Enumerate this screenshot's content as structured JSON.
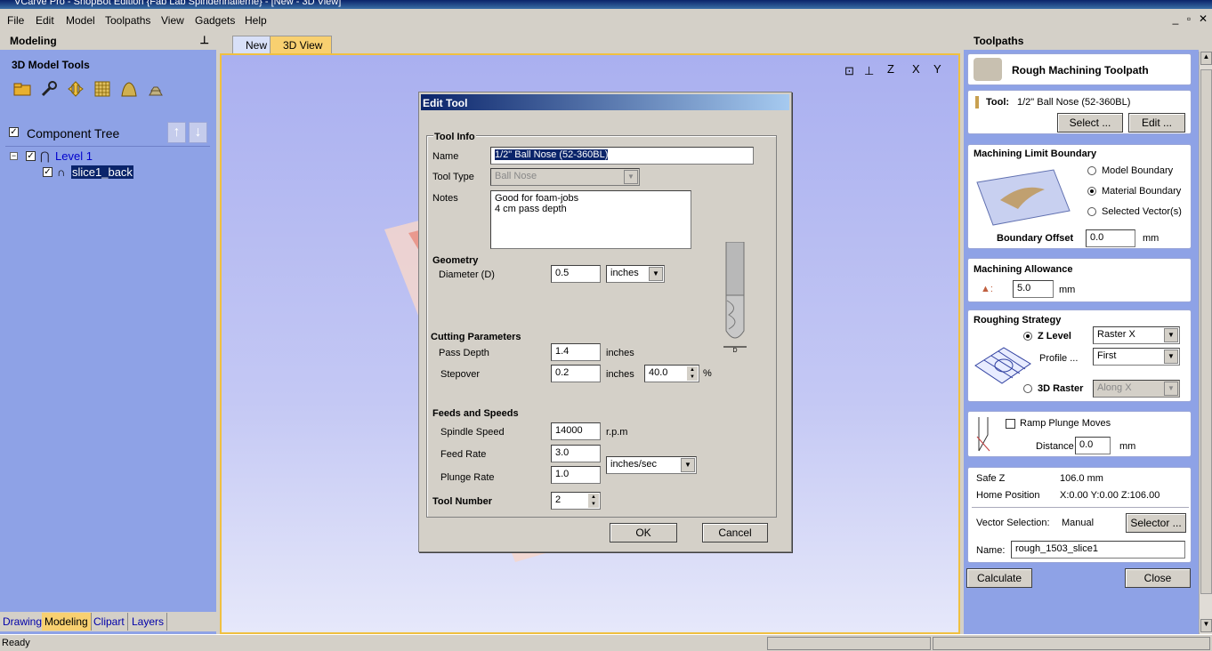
{
  "window": {
    "title": "VCarve Pro - ShopBot Edition {Fab Lab Spinderihallerne} - [New - 3D View]"
  },
  "menu": [
    "File",
    "Edit",
    "Model",
    "Toolpaths",
    "View",
    "Gadgets",
    "Help"
  ],
  "left": {
    "header": "Modeling",
    "tools_title": "3D Model Tools",
    "tree_title": "Component Tree",
    "tree": {
      "level": "Level 1",
      "component": "slice1_back"
    },
    "tabs": [
      "Drawing",
      "Modeling",
      "Clipart",
      "Layers"
    ]
  },
  "view_tabs": [
    "New",
    "3D View"
  ],
  "dialog": {
    "title": "Edit Tool",
    "tool_info": "Tool Info",
    "name_label": "Name",
    "name_value": "1/2\" Ball Nose  (52-360BL)",
    "tooltype_label": "Tool Type",
    "tooltype_value": "Ball Nose",
    "notes_label": "Notes",
    "notes_line1": "Good for foam-jobs",
    "notes_line2": "4 cm pass depth",
    "geometry": "Geometry",
    "diameter_label": "Diameter (D)",
    "diameter_value": "0.5",
    "diameter_units": "inches",
    "cutting": "Cutting Parameters",
    "pass_label": "Pass Depth",
    "pass_value": "1.4",
    "pass_units": "inches",
    "stepover_label": "Stepover",
    "stepover_value": "0.2",
    "stepover_units": "inches",
    "stepover_pct": "40.0",
    "pct": "%",
    "feeds": "Feeds and Speeds",
    "spindle_label": "Spindle Speed",
    "spindle_value": "14000",
    "spindle_units": "r.p.m",
    "feed_label": "Feed Rate",
    "feed_value": "3.0",
    "plunge_label": "Plunge Rate",
    "plunge_value": "1.0",
    "rate_units": "inches/sec",
    "toolnum_label": "Tool Number",
    "toolnum_value": "2",
    "ok": "OK",
    "cancel": "Cancel",
    "d_mark": "D"
  },
  "right": {
    "header": "Toolpaths",
    "title": "Rough Machining Toolpath",
    "tool_label": "Tool:",
    "tool_value": "1/2\" Ball Nose  (52-360BL)",
    "select_btn": "Select ...",
    "edit_btn": "Edit ...",
    "boundary_title": "Machining Limit Boundary",
    "model_boundary": "Model Boundary",
    "material_boundary": "Material Boundary",
    "selected_vectors": "Selected Vector(s)",
    "boundary_offset_label": "Boundary Offset",
    "boundary_offset_value": "0.0",
    "mm": "mm",
    "allowance_title": "Machining Allowance",
    "allowance_value": "5.0",
    "roughing_title": "Roughing Strategy",
    "zlevel": "Z Level",
    "zlevel_value": "Raster X",
    "profile_label": "Profile ...",
    "profile_value": "First",
    "raster3d": "3D Raster",
    "raster3d_value": "Along X",
    "ramp_label": "Ramp Plunge Moves",
    "distance_label": "Distance",
    "distance_value": "0.0",
    "safez_label": "Safe Z",
    "safez_value": "106.0 mm",
    "home_label": "Home Position",
    "home_value": "X:0.00 Y:0.00 Z:106.00",
    "vecsel_label": "Vector Selection:",
    "vecsel_value": "Manual",
    "selector_btn": "Selector ...",
    "name_label": "Name:",
    "name_value": "rough_1503_slice1",
    "calculate": "Calculate",
    "close": "Close"
  },
  "view_icons": {
    "z": "Z",
    "x": "X",
    "y": "Y"
  },
  "status": "Ready",
  "colors": {
    "panel": "#8ea2e6",
    "accent": "#f0c040",
    "title": "#0a246a"
  }
}
